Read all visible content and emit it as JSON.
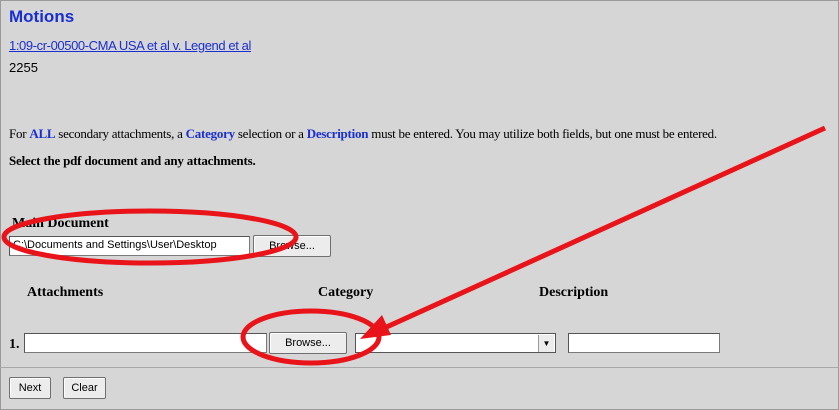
{
  "page": {
    "title": "Motions",
    "case_link": "1:09-cr-00500-CMA USA et al v. Legend et al",
    "case_number": "2255"
  },
  "instructions": {
    "part1": "For ",
    "all": "ALL",
    "part2": " secondary attachments, a ",
    "category": "Category",
    "part3": " selection or a ",
    "description": "Description",
    "part4": " must be entered. You may utilize both fields, but one must be entered.",
    "select_line": "Select the pdf document and any attachments."
  },
  "main_document": {
    "label": "Main Document",
    "path_value": "C:\\Documents and Settings\\User\\Desktop",
    "browse_label": "Browse..."
  },
  "attachments": {
    "headers": {
      "attachments": "Attachments",
      "category": "Category",
      "description": "Description"
    },
    "rows": [
      {
        "number": "1.",
        "file_value": "",
        "browse_label": "Browse...",
        "category_value": "",
        "description_value": ""
      }
    ]
  },
  "actions": {
    "next_label": "Next",
    "clear_label": "Clear"
  },
  "annotation": {
    "color": "#e8141a"
  }
}
